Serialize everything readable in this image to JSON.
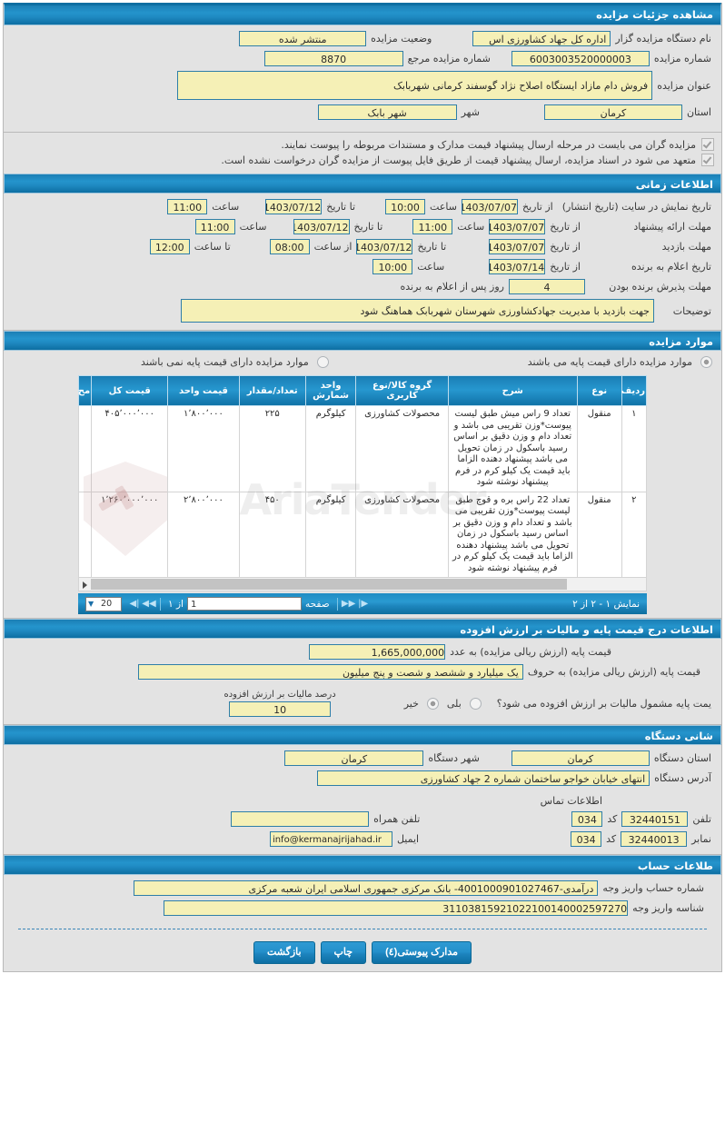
{
  "header": {
    "title": "مشاهده جزئیات مزایده"
  },
  "details": {
    "org_label": "نام دستگاه مزایده گزار",
    "org_value": "اداره کل جهاد کشاورزی اس",
    "status_label": "وضعیت مزایده",
    "status_value": "منتشر شده",
    "number_label": "شماره مزایده",
    "number_value": "6003003520000003",
    "ref_label": "شماره مزایده مرجع",
    "ref_value": "8870",
    "title_label": "عنوان مزایده",
    "title_value": "فروش دام مازاد ایستگاه اصلاح نژاد گوسفند کرمانی شهربابک",
    "province_label": "استان",
    "province_value": "کرمان",
    "city_label": "شهر",
    "city_value": "شهر بابک",
    "note1": "مزایده گران می بایست در مرحله ارسال پیشنهاد قیمت مدارک و مستندات مربوطه را پیوست نمایند.",
    "note2": "متعهد می شود در اسناد مزایده، ارسال پیشنهاد قیمت از طریق فایل پیوست از مزایده گران درخواست نشده است."
  },
  "timing": {
    "section_title": "اطلاعات زمانی",
    "from_date_label": "از تاریخ",
    "to_date_label": "تا تاریخ",
    "hour_label": "ساعت",
    "from_hour_label": "از ساعت",
    "to_hour_label": "تا ساعت",
    "rows": [
      {
        "label": "تاریخ نمایش در سایت (تاریخ انتشار)",
        "from_date": "1403/07/07",
        "from_time": "10:00",
        "to_date": "1403/07/12",
        "to_time": "11:00"
      },
      {
        "label": "مهلت ارائه پیشنهاد",
        "from_date": "1403/07/07",
        "from_time": "11:00",
        "to_date": "1403/07/12",
        "to_time": "11:00"
      },
      {
        "label": "مهلت بازدید",
        "from_date": "1403/07/07",
        "from_time": "08:00",
        "to_date": "1403/07/12",
        "to_time": "12:00"
      }
    ],
    "winner_label": "تاریخ اعلام به برنده",
    "winner_from_label": "از تاریخ",
    "winner_date": "1403/07/14",
    "winner_time": "10:00",
    "accept_label": "مهلت پذیرش برنده بودن",
    "accept_days": "4",
    "accept_suffix": "روز پس از اعلام به برنده",
    "desc_label": "توضیحات",
    "desc_value": "جهت بازدید با مدیریت جهادکشاورزی شهرستان شهربابک هماهنگ شود"
  },
  "items": {
    "section_title": "موارد مزایده",
    "radio_with_base": "موارد مزایده دارای قیمت پایه می باشند",
    "radio_without_base": "موارد مزایده دارای قیمت پایه نمی باشند",
    "columns": [
      "ردیف",
      "نوع",
      "شرح",
      "گروه کالا/نوع کاربری",
      "واحد شمارش",
      "تعداد/مقدار",
      "قیمت واحد",
      "قیمت کل",
      "مح"
    ],
    "rows": [
      {
        "index": "۱",
        "type": "منقول",
        "desc": "تعداد 9 راس میش طبق لیست پیوست*وزن تقریبی می باشد و تعداد دام و وزن دقیق بر اساس رسید باسکول در زمان تحویل می باشد پیشنهاد دهنده الزاما باید قیمت یک کیلو کرم در فرم پیشنهاد نوشته شود",
        "group": "محصولات کشاورزی",
        "unit": "کیلوگرم",
        "qty": "۲۲۵",
        "unit_price": "۱٬۸۰۰٬۰۰۰",
        "total_price": "۴۰۵٬۰۰۰٬۰۰۰"
      },
      {
        "index": "۲",
        "type": "منقول",
        "desc": "تعداد 22 راس بره و قوچ طبق لیست پیوست*وزن تقریبی می باشد و تعداد دام و وزن دقیق بر اساس رسید باسکول در زمان تحویل می باشد پیشنهاد دهنده الزاما باید قیمت یک کیلو کرم در فرم پیشنهاد نوشته شود",
        "group": "محصولات کشاورزی",
        "unit": "کیلوگرم",
        "qty": "۴۵۰",
        "unit_price": "۲٬۸۰۰٬۰۰۰",
        "total_price": "۱٬۲۶۰٬۰۰۰٬۰۰۰"
      }
    ],
    "pager": {
      "summary": "نمایش ۱ - ۲ از ۲",
      "page_label": "صفحه",
      "page_value": "1",
      "of_label": "از ۱",
      "page_size": "20",
      "first_icon": "▶|",
      "prev_icon": "▶▶",
      "next_icon": "◀◀",
      "last_icon": "|◀"
    }
  },
  "pricing": {
    "section_title": "اطلاعات درج قیمت پایه و مالیات بر ارزش افزوده",
    "base_price_label": "قیمت پایه (ارزش ریالی مزایده) به عدد",
    "base_price_value": "1,665,000,000",
    "base_words_label": "قیمت پایه (ارزش ریالی مزایده) به حروف",
    "base_words_value": "یک میلیارد و ششصد و شصت و پنج میلیون",
    "vat_question": "یمت پایه مشمول مالیات بر ارزش افزوده می شود؟",
    "vat_yes": "بلی",
    "vat_no": "خیر",
    "vat_percent_label": "درصد مالیات بر ارزش افزوده",
    "vat_percent_value": "10"
  },
  "address": {
    "section_title": "شانی دستگاه",
    "province_label": "استان دستگاه",
    "province_value": "کرمان",
    "city_label": "شهر دستگاه",
    "city_value": "کرمان",
    "address_label": "آدرس دستگاه",
    "address_value": "انتهای خیابان خواجو ساختمان شماره 2 جهاد کشاورزی",
    "contact_title": "اطلاعات تماس",
    "phone_label": "تلفن",
    "phone_value": "32440151",
    "phone_code_label": "کد",
    "phone_code_value": "034",
    "mobile_label": "تلفن همراه",
    "mobile_value": "",
    "fax_label": "نمابر",
    "fax_value": "32440013",
    "fax_code_label": "کد",
    "fax_code_value": "034",
    "email_label": "ایمیل",
    "email_value": "info@kermanajrijahad.ir"
  },
  "account": {
    "section_title": "طلاعات حساب",
    "account_label": "شماره حساب واریز وجه",
    "account_value": "درآمدی-4001000901027467- بانک مرکزی جمهوری اسلامی ایران شعبه مرکزی",
    "shenase_label": "شناسه واریز وجه",
    "shenase_value": "31103815921022100140002597270"
  },
  "footer": {
    "attachments_button": "مدارک پیوستی(٤)",
    "print_button": "چاپ",
    "back_button": "بازگشت"
  },
  "watermark": {
    "text": "AriaTender"
  }
}
